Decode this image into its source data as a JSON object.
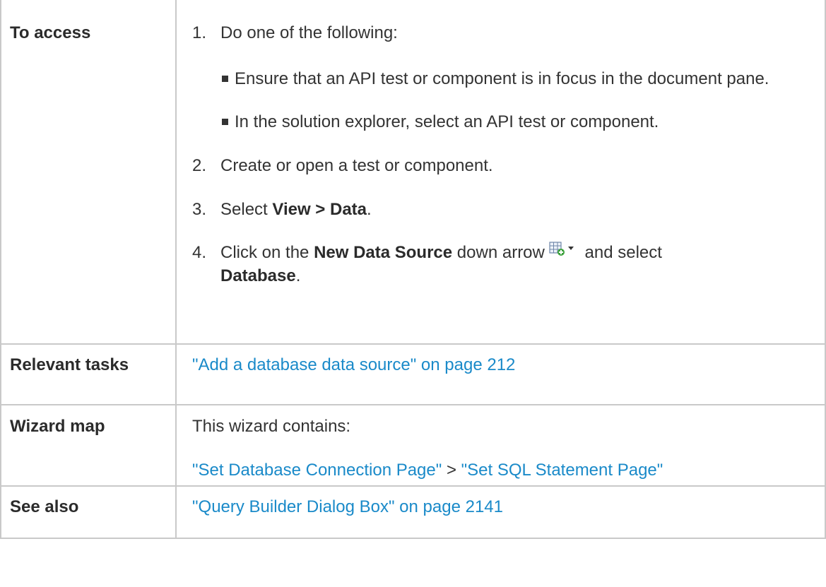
{
  "rows": {
    "access": {
      "label": "To access",
      "step1": {
        "num": "1.",
        "text": "Do one of the following:",
        "bullets": [
          "Ensure that an API test or component is in focus in the document pane.",
          "In the solution explorer, select an API test or component."
        ]
      },
      "step2": {
        "num": "2.",
        "text": "Create or open a test or component."
      },
      "step3": {
        "num": "3.",
        "prefix": "Select ",
        "bold": "View > Data",
        "suffix": "."
      },
      "step4": {
        "num": "4.",
        "prefix": "Click on the ",
        "bold": "New Data Source",
        "middle": " down arrow",
        "after_icon": " and select",
        "bold2": "Database",
        "suffix": ".",
        "icon": "new-data-source-icon"
      }
    },
    "tasks": {
      "label": "Relevant tasks",
      "link": "\"Add a database data source\" on page 212"
    },
    "wizard": {
      "label": "Wizard map",
      "intro": "This wizard contains:",
      "link1": "\"Set Database Connection Page\"",
      "separator": " > ",
      "link2": "\"Set SQL Statement Page\""
    },
    "see_also": {
      "label": "See also",
      "link": "\"Query Builder Dialog Box\" on page 2141"
    }
  },
  "colors": {
    "link": "#1a8ac9",
    "border": "#c9c9c9",
    "text": "#333333"
  }
}
